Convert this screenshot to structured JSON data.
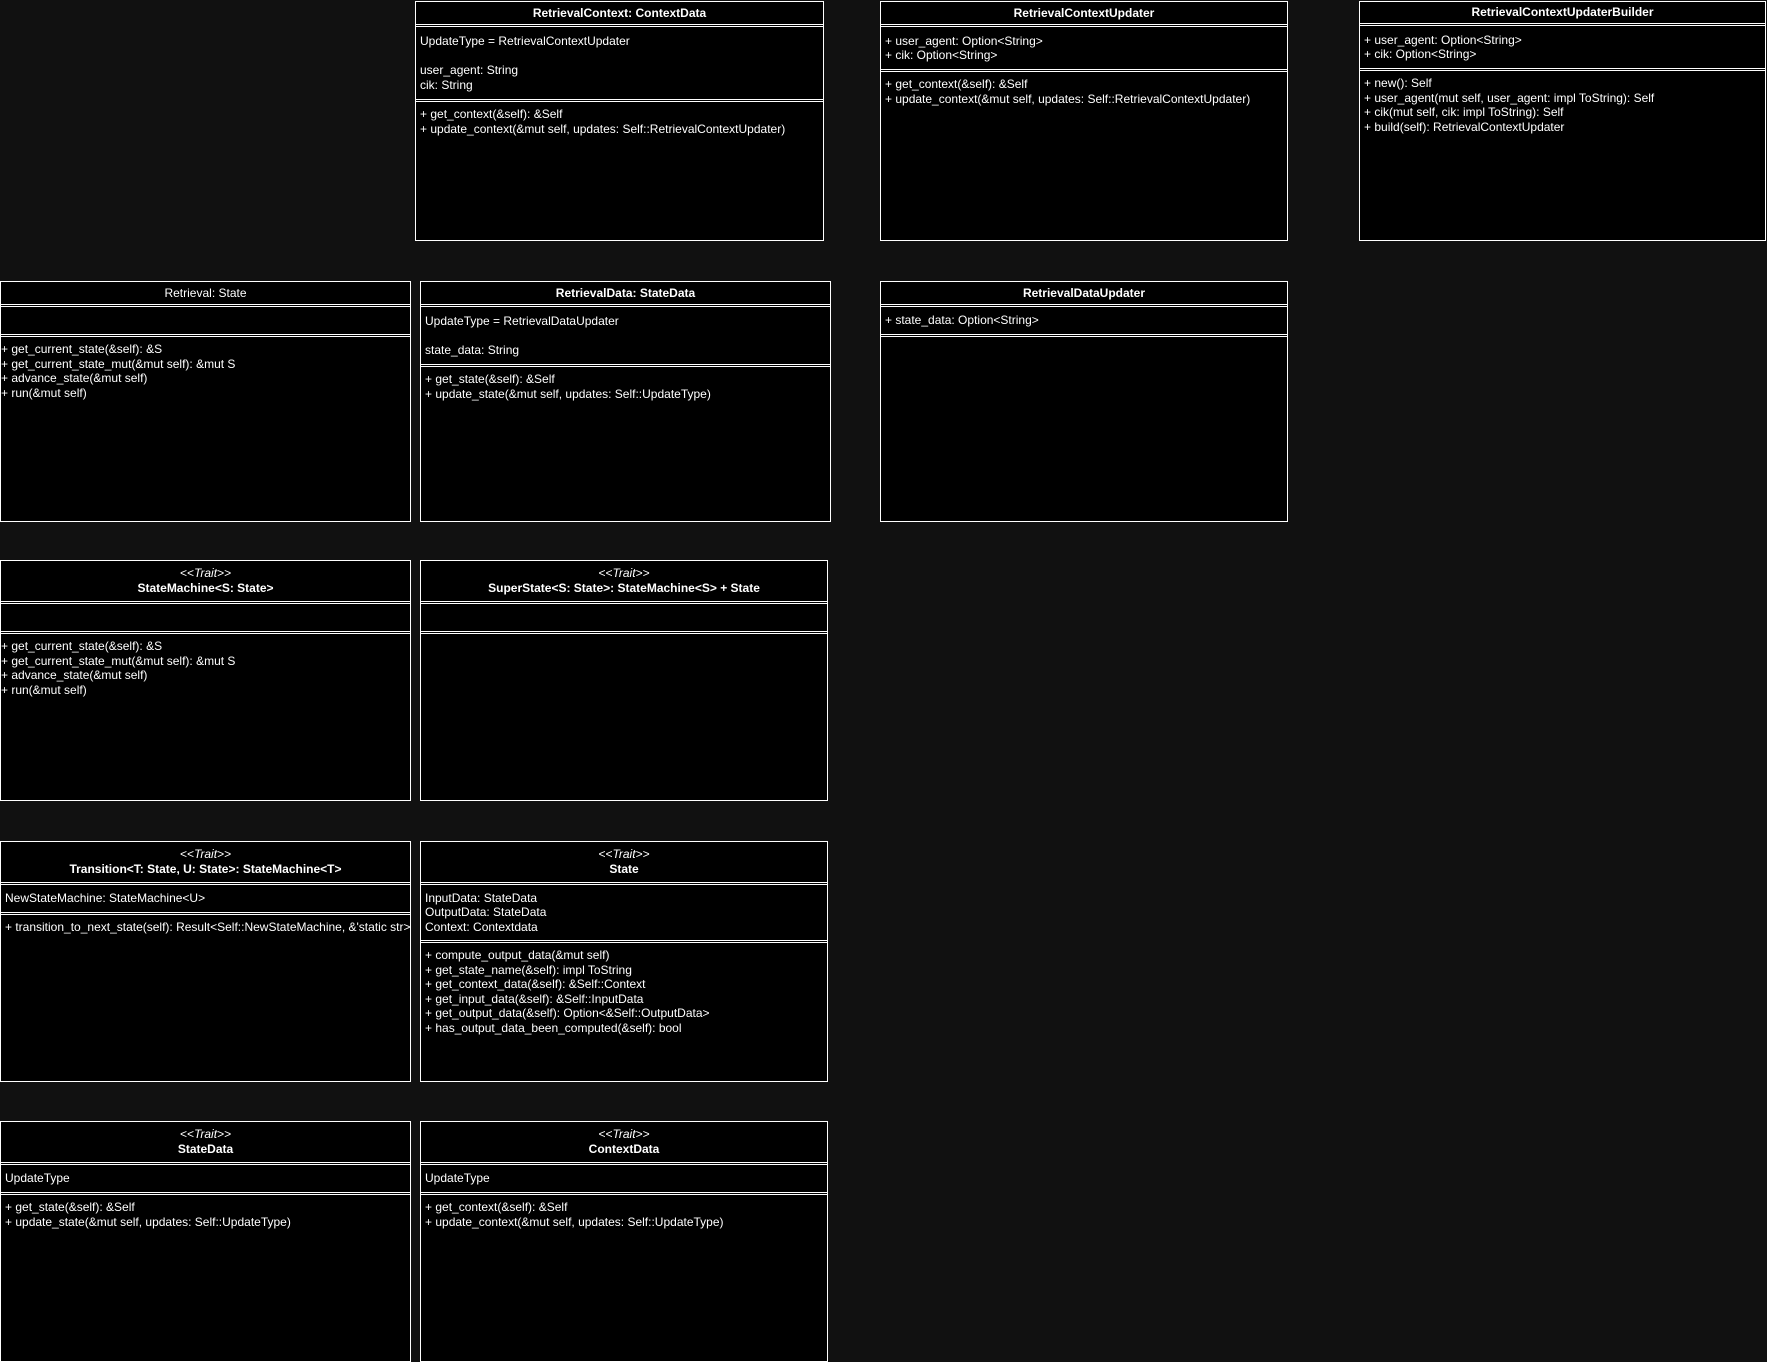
{
  "background_color": "#111111",
  "box_color": "#000000",
  "line_color": "#ffffff",
  "boxes": {
    "retrieval_context": {
      "title": "RetrievalContext: ContextData",
      "attrs": [
        "UpdateType = RetrievalContextUpdater",
        "",
        "user_agent: String",
        "cik: String"
      ],
      "methods": [
        "+ get_context(&self): &Self",
        "+ update_context(&mut self, updates: Self::RetrievalContextUpdater)"
      ]
    },
    "retrieval_context_updater": {
      "title": "RetrievalContextUpdater",
      "attrs": [
        "+ user_agent: Option<String>",
        "+ cik: Option<String>"
      ],
      "methods": [
        "+ get_context(&self): &Self",
        "+ update_context(&mut self, updates: Self::RetrievalContextUpdater)"
      ]
    },
    "retrieval_context_updater_builder": {
      "title": "RetrievalContextUpdaterBuilder",
      "attrs": [
        "+ user_agent: Option<String>",
        "+ cik: Option<String>"
      ],
      "methods": [
        "+ new(): Self",
        "+ user_agent(mut self, user_agent: impl ToString): Self",
        "+ cik(mut self, cik: impl ToString): Self",
        "+ build(self): RetrievalContextUpdater"
      ]
    },
    "retrieval_state": {
      "title": "Retrieval: State",
      "attrs": [],
      "methods": [
        "+ get_current_state(&self): &S",
        "+ get_current_state_mut(&mut self): &mut S",
        "+ advance_state(&mut self)",
        "+ run(&mut self)"
      ]
    },
    "retrieval_data": {
      "title": "RetrievalData: StateData",
      "attrs": [
        "UpdateType = RetrievalDataUpdater",
        "",
        "state_data: String"
      ],
      "methods": [
        "+ get_state(&self): &Self",
        "+ update_state(&mut self, updates: Self::UpdateType)"
      ]
    },
    "retrieval_data_updater": {
      "title": "RetrievalDataUpdater",
      "attrs": [
        "+ state_data: Option<String>"
      ],
      "methods": []
    },
    "state_machine": {
      "stereotype": "<<Trait>>",
      "title": "StateMachine<S: State>",
      "attrs": [],
      "methods": [
        "+ get_current_state(&self): &S",
        "+ get_current_state_mut(&mut self): &mut S",
        "+ advance_state(&mut self)",
        "+ run(&mut self)"
      ]
    },
    "super_state": {
      "stereotype": "<<Trait>>",
      "title": "SuperState<S: State>: StateMachine<S> + State",
      "attrs": [],
      "methods": []
    },
    "transition": {
      "stereotype": "<<Trait>>",
      "title": "Transition<T: State, U: State>: StateMachine<T>",
      "attrs": [
        "NewStateMachine: StateMachine<U>"
      ],
      "methods": [
        "+ transition_to_next_state(self): Result<Self::NewStateMachine, &'static str>"
      ]
    },
    "state": {
      "stereotype": "<<Trait>>",
      "title": "State",
      "attrs": [
        "InputData: StateData",
        "OutputData: StateData",
        "Context: Contextdata"
      ],
      "methods": [
        "+ compute_output_data(&mut self)",
        "+ get_state_name(&self): impl ToString",
        "+ get_context_data(&self): &Self::Context",
        "+ get_input_data(&self): &Self::InputData",
        "+ get_output_data(&self): Option<&Self::OutputData>",
        "+ has_output_data_been_computed(&self): bool"
      ]
    },
    "state_data": {
      "stereotype": "<<Trait>>",
      "title": "StateData",
      "attrs": [
        "UpdateType"
      ],
      "methods": [
        "+ get_state(&self): &Self",
        "+ update_state(&mut self, updates: Self::UpdateType)"
      ]
    },
    "context_data": {
      "stereotype": "<<Trait>>",
      "title": "ContextData",
      "attrs": [
        "UpdateType"
      ],
      "methods": [
        "+ get_context(&self): &Self",
        "+ update_context(&mut self, updates: Self::UpdateType)"
      ]
    }
  }
}
